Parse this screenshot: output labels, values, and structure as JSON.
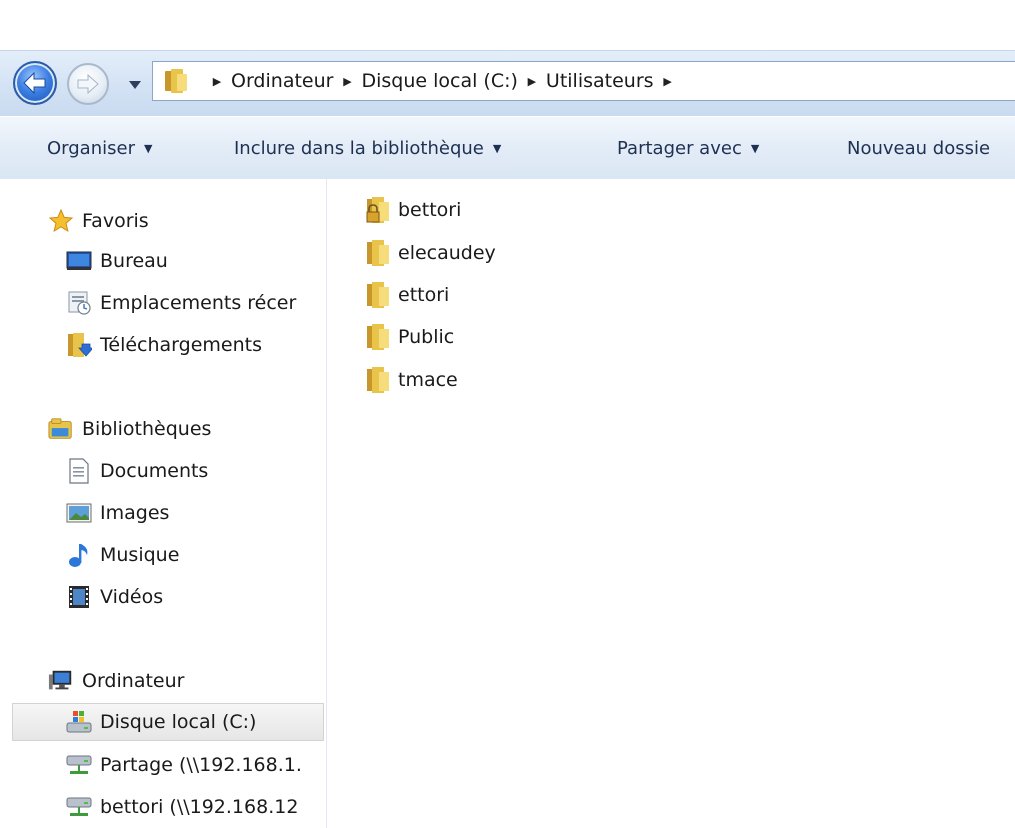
{
  "address": {
    "crumbs": [
      "Ordinateur",
      "Disque local (C:)",
      "Utilisateurs"
    ]
  },
  "toolbar": {
    "organise": "Organiser",
    "include": "Inclure dans la bibliothèque",
    "share": "Partager avec",
    "new_folder": "Nouveau dossie"
  },
  "nav": {
    "favorites": {
      "label": "Favoris",
      "items": [
        "Bureau",
        "Emplacements récer",
        "Téléchargements"
      ]
    },
    "libraries": {
      "label": "Bibliothèques",
      "items": [
        "Documents",
        "Images",
        "Musique",
        "Vidéos"
      ]
    },
    "computer": {
      "label": "Ordinateur",
      "items": [
        "Disque local (C:)",
        "Partage (\\\\192.168.1.",
        "bettori (\\\\192.168.12"
      ]
    }
  },
  "files": [
    "bettori",
    "elecaudey",
    "ettori",
    "Public",
    "tmace"
  ],
  "icons": {
    "back": "back-arrow-icon",
    "forward": "forward-arrow-icon",
    "folder": "folder-icon",
    "locked_folder": "locked-folder-icon",
    "star": "star-icon",
    "desktop": "desktop-icon",
    "recent": "recent-places-icon",
    "downloads": "downloads-icon",
    "library": "library-icon",
    "documents": "documents-icon",
    "images": "images-icon",
    "music": "music-icon",
    "videos": "videos-icon",
    "computer": "computer-icon",
    "drive": "local-drive-icon",
    "network": "network-drive-icon"
  },
  "colors": {
    "nav_bg": "#d3e2f4",
    "command_bar": "#e3ecf7",
    "folder_yellow": "#e8c54a",
    "back_button": "#3d7fe3"
  }
}
